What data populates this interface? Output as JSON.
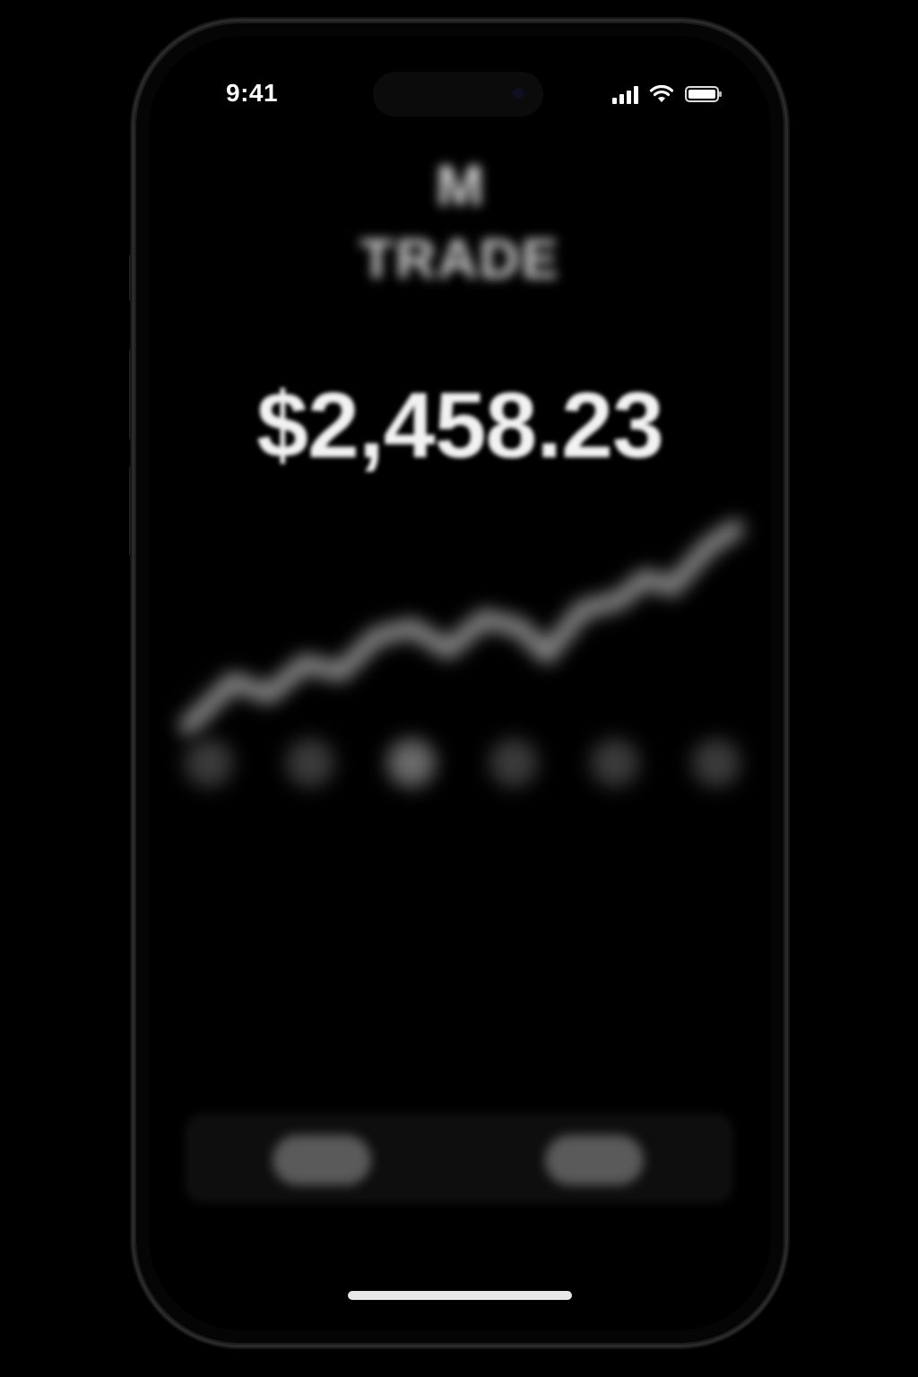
{
  "status_bar": {
    "time": "9:41",
    "signal_bars": 4,
    "battery_level": 1.0,
    "icons": [
      "cellular-signal-icon",
      "wifi-icon",
      "battery-icon"
    ]
  },
  "app": {
    "logo_letter": "M",
    "brand_name": "TRADE",
    "brand_subtitle": "",
    "balance": "$2,458.23",
    "chart_trend": "up",
    "range_buttons": [
      "",
      "",
      "",
      "",
      "",
      ""
    ],
    "active_range_index": 2,
    "stats": [
      {
        "label": "",
        "mid": "",
        "value": ""
      },
      {
        "label": "",
        "mid": "",
        "value": ""
      },
      {
        "label": "",
        "mid": "",
        "value": ""
      },
      {
        "label": "",
        "mid": "",
        "value": ""
      },
      {
        "label": "",
        "mid": "",
        "value": ""
      }
    ],
    "actions": {
      "buy_label": "",
      "sell_label": ""
    }
  },
  "colors": {
    "background": "#000000",
    "text_primary": "#f2f2f2",
    "line_chart": "#8c8c8c"
  }
}
